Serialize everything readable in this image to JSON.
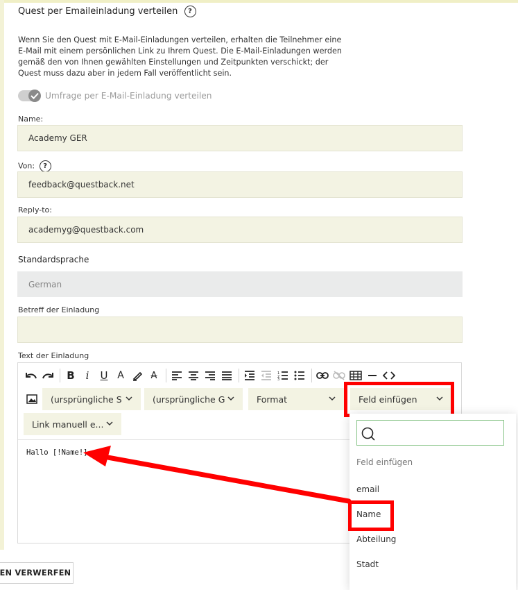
{
  "section": {
    "title": "Quest per Emaileinladung verteilen",
    "help": "?",
    "description": "Wenn Sie den Quest mit E-Mail-Einladungen verteilen, erhalten die Teilnehmer eine E-Mail mit einem persönlichen Link zu Ihrem Quest. Die E-Mail-Einladungen werden gemäß den von Ihnen gewählten Einstellungen und Zeitpunkten verschickt; der Quest muss dazu aber in jedem Fall veröffentlicht sein.",
    "toggle_label": "Umfrage per E-Mail-Einladung verteilen",
    "toggle_on": true
  },
  "form": {
    "name_label": "Name:",
    "name_value": "Academy GER",
    "from_label": "Von:",
    "from_help": "?",
    "from_value": "feedback@questback.net",
    "reply_label": "Reply-to:",
    "reply_value": "academyg@questback.com",
    "language_label": "Standardsprache",
    "language_value": "German",
    "subject_label": "Betreff der Einladung",
    "subject_value": "",
    "text_label": "Text der Einladung"
  },
  "editor": {
    "font_family": "(ursprüngliche S",
    "font_size": "(ursprüngliche G",
    "format": "Format",
    "insert_field": "Feld einfügen",
    "link_manual": "Link manuell e...",
    "content": "Hallo [!Name!]",
    "toolbar": {
      "bold": "B",
      "italic": "i",
      "underline": "U",
      "font_color": "A",
      "clear_format": "A"
    }
  },
  "dropdown": {
    "search_placeholder": "",
    "items": [
      "Feld einfügen",
      "email",
      "Name",
      "Abteilung",
      "Stadt"
    ]
  },
  "footer": {
    "discard_label": "EN VERWERFEN"
  },
  "colors": {
    "field_bg": "#f3f3e3",
    "highlight": "#ff0000",
    "accent_border": "#8ac58a"
  }
}
